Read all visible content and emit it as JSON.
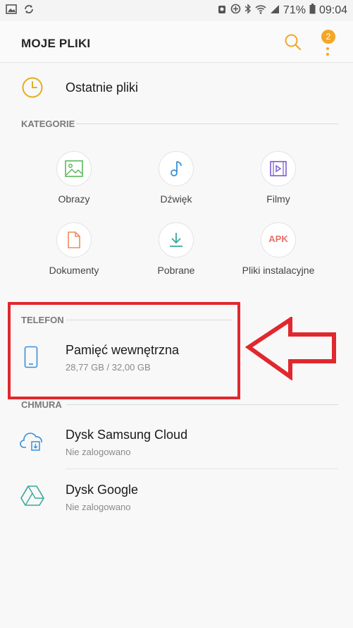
{
  "status_bar": {
    "battery": "71%",
    "time": "09:04"
  },
  "app_bar": {
    "title": "MOJE PLIKI",
    "notification_count": "2"
  },
  "recent": {
    "label": "Ostatnie pliki"
  },
  "categories": {
    "header": "KATEGORIE",
    "items": [
      {
        "label": "Obrazy",
        "icon": "image-icon",
        "color": "#5cb85c"
      },
      {
        "label": "Dźwięk",
        "icon": "music-note-icon",
        "color": "#3a8fd8"
      },
      {
        "label": "Filmy",
        "icon": "video-icon",
        "color": "#7d5bd6"
      },
      {
        "label": "Dokumenty",
        "icon": "document-icon",
        "color": "#f08a5d"
      },
      {
        "label": "Pobrane",
        "icon": "download-icon",
        "color": "#3aa89a"
      },
      {
        "label": "Pliki instalacyjne",
        "icon": "apk-icon",
        "color": "#e8706a",
        "badge_text": "APK"
      }
    ]
  },
  "phone": {
    "header": "TELEFON",
    "internal_storage": {
      "title": "Pamięć wewnętrzna",
      "subtitle": "28,77 GB / 32,00 GB"
    }
  },
  "cloud": {
    "header": "CHMURA",
    "items": [
      {
        "title": "Dysk Samsung Cloud",
        "subtitle": "Nie zalogowano"
      },
      {
        "title": "Dysk Google",
        "subtitle": "Nie zalogowano"
      }
    ]
  },
  "colors": {
    "accent": "#f5a623",
    "highlight_annotation": "#e0282e"
  }
}
